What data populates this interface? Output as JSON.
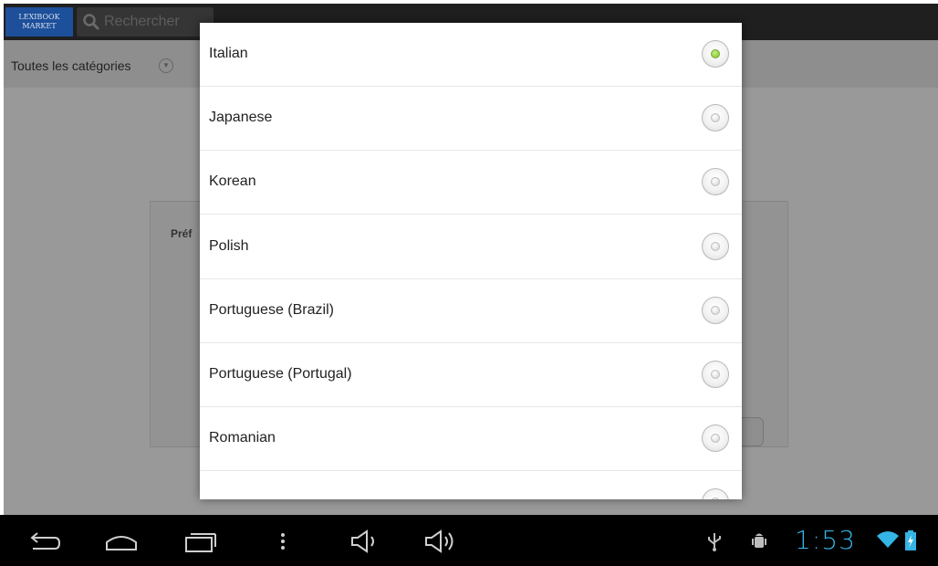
{
  "app": {
    "logo_line1": "LEXIBOOK",
    "logo_line2": "MARKET",
    "search_placeholder": "Rechercher",
    "category_spinner": "Toutes les catégories",
    "panel_label": "Préf"
  },
  "dialog": {
    "selected_index": 0,
    "options": [
      {
        "label": "Italian",
        "checked": true
      },
      {
        "label": "Japanese",
        "checked": false
      },
      {
        "label": "Korean",
        "checked": false
      },
      {
        "label": "Polish",
        "checked": false
      },
      {
        "label": "Portuguese (Brazil)",
        "checked": false
      },
      {
        "label": "Portuguese (Portugal)",
        "checked": false
      },
      {
        "label": "Romanian",
        "checked": false
      }
    ]
  },
  "navbar": {
    "time": "1:53",
    "icons": [
      "back-icon",
      "home-icon",
      "recent-apps-icon",
      "menu-icon",
      "volume-down-icon",
      "volume-up-icon",
      "usb-icon",
      "debug-icon",
      "wifi-icon",
      "battery-charging-icon"
    ]
  },
  "colors": {
    "accent_clock": "#33b5e5",
    "radio_selected": "#7fbe2a",
    "dim_background": "#999999"
  }
}
